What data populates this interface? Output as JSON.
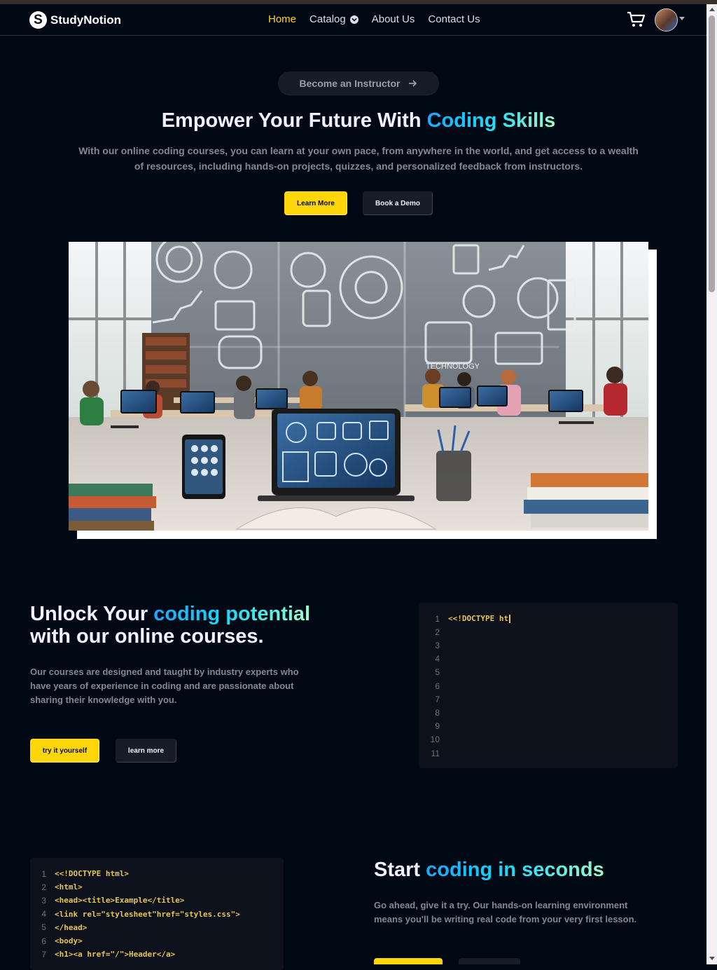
{
  "brand": {
    "name": "StudyNotion",
    "logo_letter": "S"
  },
  "nav": {
    "items": [
      {
        "label": "Home",
        "active": true
      },
      {
        "label": "Catalog",
        "has_dropdown": true
      },
      {
        "label": "About Us"
      },
      {
        "label": "Contact Us"
      }
    ],
    "cart_icon": "cart-icon",
    "avatar_icon": "user-avatar"
  },
  "hero": {
    "instructor_button": "Become an Instructor",
    "title_plain": "Empower Your Future With ",
    "title_highlight": "Coding Skills",
    "description": "With our online coding courses, you can learn at your own pace, from anywhere in the world, and get access to a wealth of resources, including hands-on projects, quizzes, and personalized feedback from instructors.",
    "learn_more": "Learn More",
    "book_demo": "Book a Demo",
    "media_text": "TECHNOLOGY"
  },
  "section1": {
    "title_plain": "Unlock Your ",
    "title_highlight": "coding potential",
    "title_line2": "with our online courses.",
    "description": "Our courses are designed and taught by industry experts who have years of experience in coding and are passionate about sharing their knowledge with you.",
    "primary_button": "try it yourself",
    "secondary_button": "learn more",
    "code": {
      "line_numbers": [
        "1",
        "2",
        "3",
        "4",
        "5",
        "6",
        "7",
        "8",
        "9",
        "10",
        "11"
      ],
      "typed_text": "<<!DOCTYPE ht"
    }
  },
  "section2": {
    "title_plain": "Start ",
    "title_highlight": "coding in seconds",
    "description": "Go ahead, give it a try. Our hands-on learning environment means you'll be writing real code from your very first lesson.",
    "code": {
      "lines": [
        {
          "n": "1",
          "text": "<<!DOCTYPE html>"
        },
        {
          "n": "2",
          "text": "<html>"
        },
        {
          "n": "3",
          "text": "<head><title>Example</title>"
        },
        {
          "n": "4",
          "text": "<link rel=\"stylesheet\"href=\"styles.css\">"
        },
        {
          "n": "5",
          "text": "</head>"
        },
        {
          "n": "6",
          "text": "<body>"
        },
        {
          "n": "7",
          "text": "<h1><a href=\"/\">Header</a>"
        }
      ]
    }
  },
  "colors": {
    "background": "#000814",
    "accent_yellow": "#ffd60a",
    "gradient": [
      "#1fa2ff",
      "#12d8fa",
      "#a6ffcb"
    ],
    "code_text": "#e7c554",
    "muted_text": "#838894"
  }
}
